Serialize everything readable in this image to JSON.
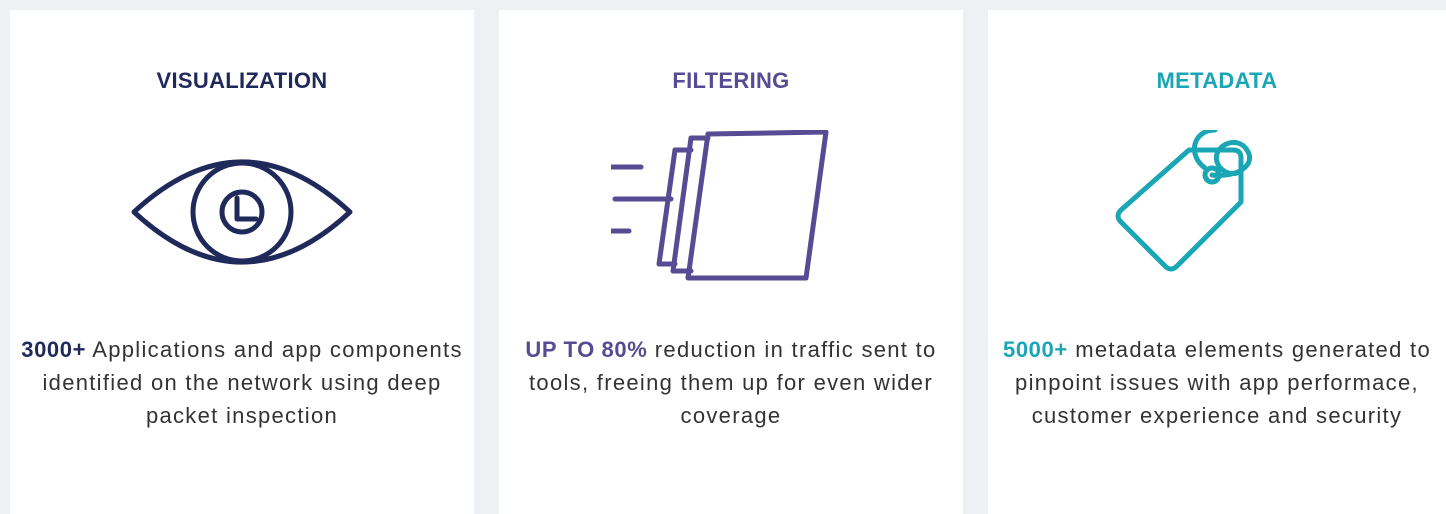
{
  "cards": [
    {
      "title": "VISUALIZATION",
      "color": "#1f2a5a",
      "icon": "eye-icon",
      "highlight": "3000+",
      "description": " Applications and app components identified on the network using deep packet inspection"
    },
    {
      "title": "FILTERING",
      "color": "#574b93",
      "icon": "filter-layers-icon",
      "highlight": "UP TO 80%",
      "description": " reduction in traffic sent to tools, freeing them up for even wider coverage"
    },
    {
      "title": "METADATA",
      "color": "#1aa6b4",
      "icon": "tag-icon",
      "highlight": "5000+",
      "description": " metadata elements generated to pinpoint issues with app performace, customer experience and security"
    }
  ]
}
